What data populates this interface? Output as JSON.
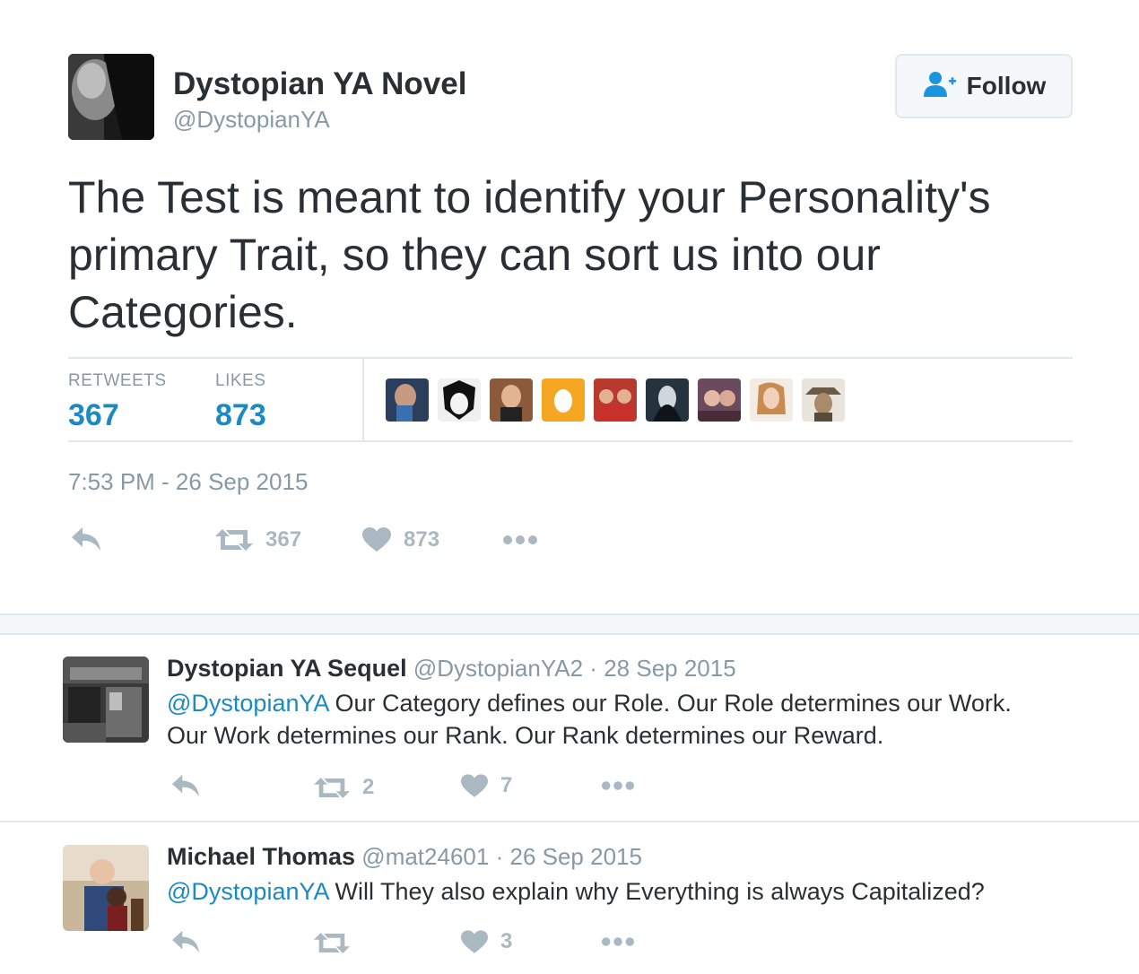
{
  "tweet": {
    "author_name": "Dystopian YA Novel",
    "author_handle": "@DystopianYA",
    "follow_label": "Follow",
    "text_lines": [
      "The Test is meant to identify your Personality's",
      "primary Trait, so they can sort us into our",
      "Categories."
    ],
    "stats": {
      "retweets_label": "RETWEETS",
      "retweets_value": "367",
      "likes_label": "LIKES",
      "likes_value": "873"
    },
    "timestamp": "7:53 PM - 26 Sep 2015",
    "actions": {
      "retweet_count": "367",
      "like_count": "873"
    }
  },
  "replies": [
    {
      "name": "Dystopian YA Sequel",
      "handle": "@DystopianYA2",
      "separator": "·",
      "date": "28 Sep 2015",
      "mention": "@DystopianYA",
      "line1_rest": " Our Category defines our Role. Our Role determines our Work.",
      "line2": "Our Work determines our Rank. Our Rank determines our Reward.",
      "retweet_count": "2",
      "like_count": "7"
    },
    {
      "name": "Michael Thomas",
      "handle": "@mat24601",
      "separator": "·",
      "date": "26 Sep 2015",
      "mention": "@DystopianYA",
      "line1_rest": " Will They also explain why Everything is always Capitalized?",
      "retweet_count": "",
      "like_count": "3"
    }
  ],
  "colors": {
    "link": "#1b8ac2",
    "muted": "#8899a6",
    "icon": "#aab8c2",
    "text": "#292f33",
    "follow_icon": "#1b95e0"
  }
}
